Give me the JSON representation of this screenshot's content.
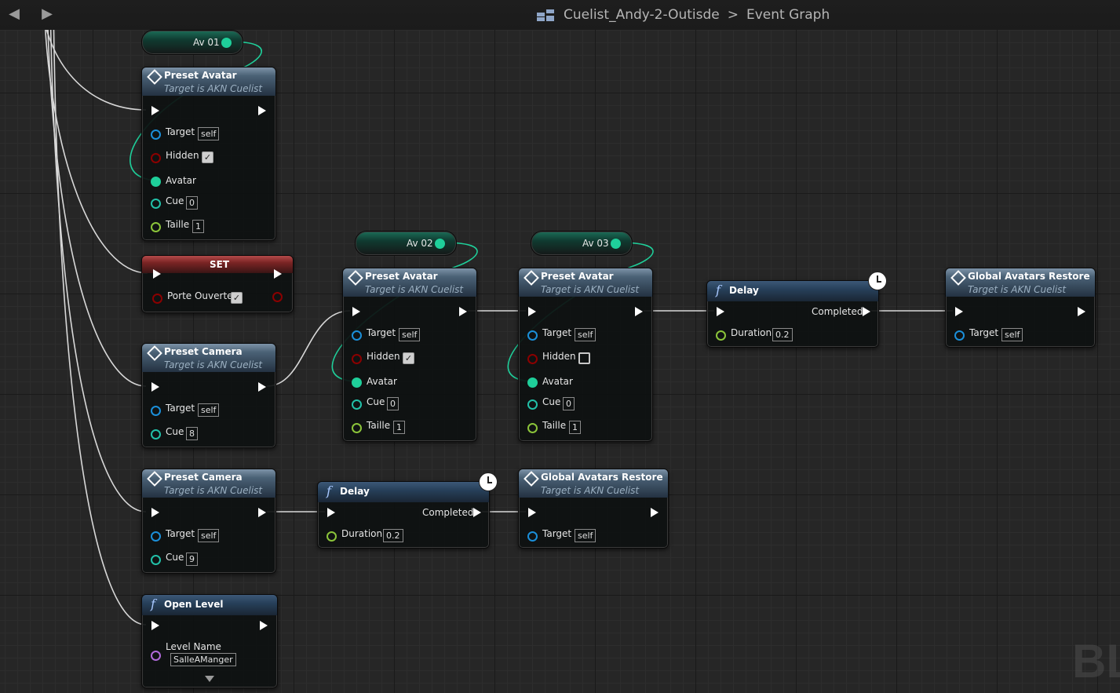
{
  "breadcrumb": {
    "blueprint": "Cuelist_Andy-2-Outisde",
    "separator": ">",
    "graph": "Event Graph"
  },
  "colors": {
    "exec": "#ffffff",
    "object": "#1b8fd9",
    "bool": "#8b0000",
    "avatar": "#1fcf9a",
    "int": "#22c0a8",
    "float": "#8bc43a",
    "name": "#b06ad9"
  },
  "vars": {
    "av01": "Av 01",
    "av02": "Av 02",
    "av03": "Av 03"
  },
  "preset_avatar_1": {
    "title": "Preset Avatar",
    "subtitle": "Target is AKN Cuelist",
    "target": "Target",
    "target_val": "self",
    "hidden": "Hidden",
    "hidden_checked": true,
    "avatar": "Avatar",
    "cue": "Cue",
    "cue_val": "0",
    "taille": "Taille",
    "taille_val": "1"
  },
  "set_node": {
    "title": "SET",
    "prop": "Porte Ouverte",
    "checked": true
  },
  "preset_camera_1": {
    "title": "Preset Camera",
    "subtitle": "Target is AKN Cuelist",
    "target": "Target",
    "target_val": "self",
    "cue": "Cue",
    "cue_val": "8"
  },
  "preset_camera_2": {
    "title": "Preset Camera",
    "subtitle": "Target is AKN Cuelist",
    "target": "Target",
    "target_val": "self",
    "cue": "Cue",
    "cue_val": "9"
  },
  "open_level": {
    "title": "Open Level",
    "level_name": "Level Name",
    "level_val": "SalleAManger"
  },
  "preset_avatar_2": {
    "title": "Preset Avatar",
    "subtitle": "Target is AKN Cuelist",
    "target": "Target",
    "target_val": "self",
    "hidden": "Hidden",
    "hidden_checked": true,
    "avatar": "Avatar",
    "cue": "Cue",
    "cue_val": "0",
    "taille": "Taille",
    "taille_val": "1"
  },
  "preset_avatar_3": {
    "title": "Preset Avatar",
    "subtitle": "Target is AKN Cuelist",
    "target": "Target",
    "target_val": "self",
    "hidden": "Hidden",
    "hidden_checked": false,
    "avatar": "Avatar",
    "cue": "Cue",
    "cue_val": "0",
    "taille": "Taille",
    "taille_val": "1"
  },
  "delay_1": {
    "title": "Delay",
    "completed": "Completed",
    "duration": "Duration",
    "duration_val": "0.2"
  },
  "delay_2": {
    "title": "Delay",
    "completed": "Completed",
    "duration": "Duration",
    "duration_val": "0.2"
  },
  "global_restore_1": {
    "title": "Global Avatars Restore",
    "subtitle": "Target is AKN Cuelist",
    "target": "Target",
    "target_val": "self"
  },
  "global_restore_2": {
    "title": "Global Avatars Restore",
    "subtitle": "Target is AKN Cuelist",
    "target": "Target",
    "target_val": "self"
  },
  "watermark": "BL"
}
